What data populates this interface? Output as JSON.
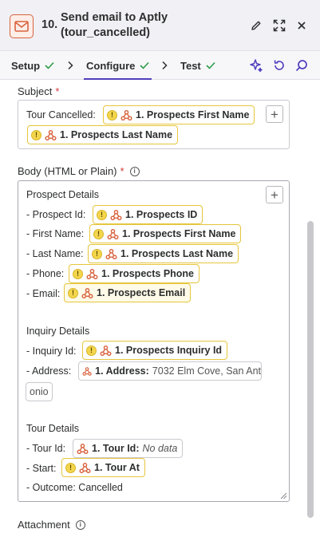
{
  "header": {
    "step_number": "10.",
    "title": "Send email to Aptly (tour_cancelled)",
    "step_icon": "envelope-icon",
    "actions": [
      "pencil-icon",
      "expand-icon",
      "close-icon"
    ]
  },
  "tabs": [
    {
      "label": "Setup",
      "status": "complete"
    },
    {
      "label": "Configure",
      "status": "complete",
      "active": true
    },
    {
      "label": "Test",
      "status": "complete"
    }
  ],
  "tools": [
    "sparkle-icon",
    "refresh-icon",
    "search-icon"
  ],
  "subject": {
    "label": "Subject",
    "required": "*",
    "prefix": "Tour Cancelled:",
    "pills": [
      "1. Prospects First Name",
      "1. Prospects Last Name"
    ]
  },
  "body": {
    "label": "Body (HTML or Plain)",
    "required": "*",
    "prospect_heading": "Prospect Details",
    "prospect_rows": [
      {
        "label": "- Prospect Id:",
        "pill": "1. Prospects ID"
      },
      {
        "label": "- First Name:",
        "pill": "1. Prospects First Name"
      },
      {
        "label": "- Last Name:",
        "pill": "1. Prospects Last Name"
      },
      {
        "label": "- Phone:",
        "pill": "1. Prospects Phone"
      },
      {
        "label": "- Email:",
        "pill": "1. Prospects Email"
      }
    ],
    "inquiry_heading": "Inquiry Details",
    "inquiry_id_label": "- Inquiry Id:",
    "inquiry_id_pill": "1. Prospects Inquiry Id",
    "address_label": "- Address:",
    "address_pill_key": "1. Address:",
    "address_pill_value": "7032 Elm Cove, San Ant",
    "address_pill_wrap": "onio",
    "tour_heading": "Tour Details",
    "tour_id_label": "- Tour Id:",
    "tour_id_pill_key": "1. Tour Id:",
    "tour_id_pill_value": "No data",
    "start_label": "- Start:",
    "start_pill": "1. Tour At",
    "outcome": "- Outcome: Cancelled"
  },
  "attachment": {
    "label": "Attachment"
  },
  "colors": {
    "accent": "#503ebd",
    "check": "#2e9d47",
    "warning_border": "#e6c63c",
    "step_icon": "#d9623e"
  }
}
